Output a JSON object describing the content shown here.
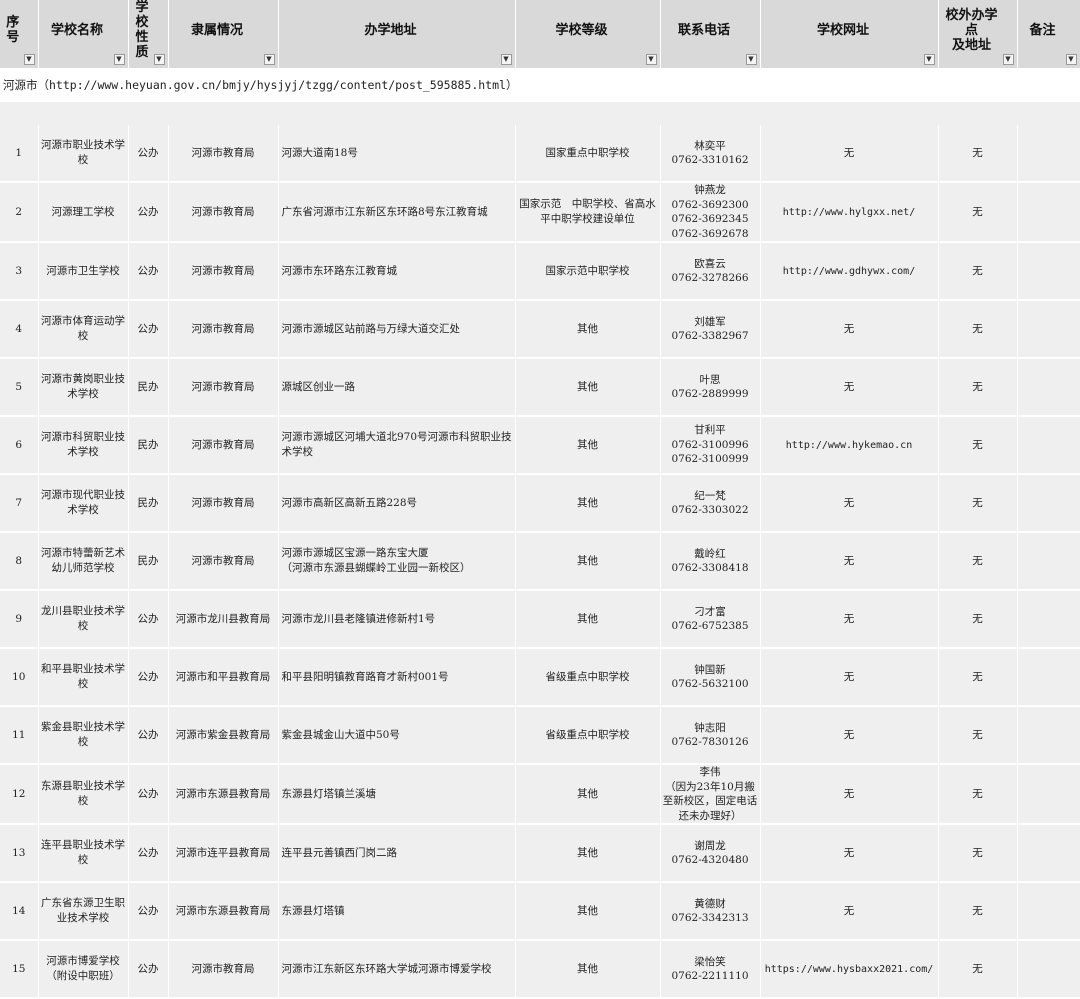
{
  "headers": [
    "序号",
    "学校名称",
    "学校\n性质",
    "隶属情况",
    "办学地址",
    "学校等级",
    "联系电话",
    "学校网址",
    "校外办学点\n及地址",
    "备注"
  ],
  "filter_icon": "dropdown-arrow",
  "city_row": "河源市（http://www.heyuan.gov.cn/bmjy/hysjyj/tzgg/content/post_595885.html）",
  "rows": [
    {
      "no": "1",
      "name": "河源市职业技术学校",
      "nature": "公办",
      "affiliation": "河源市教育局",
      "address": "河源大道南18号",
      "level": "国家重点中职学校",
      "phone": "林奕平\n0762-3310162",
      "website": "无",
      "offsite": "无",
      "remark": ""
    },
    {
      "no": "2",
      "name": "河源理工学校",
      "nature": "公办",
      "affiliation": "河源市教育局",
      "address": "广东省河源市江东新区东环路8号东江教育城",
      "level": "国家示范　中职学校、省高水平中职学校建设单位",
      "phone": "钟燕龙\n0762-3692300\n0762-3692345\n0762-3692678",
      "website": "http://www.hylgxx.net/",
      "offsite": "无",
      "remark": ""
    },
    {
      "no": "3",
      "name": "河源市卫生学校",
      "nature": "公办",
      "affiliation": "河源市教育局",
      "address": "河源市东环路东江教育城",
      "level": "国家示范中职学校",
      "phone": "欧喜云\n0762-3278266",
      "website": "http://www.gdhywx.com/",
      "offsite": "无",
      "remark": ""
    },
    {
      "no": "4",
      "name": "河源市体育运动学校",
      "nature": "公办",
      "affiliation": "河源市教育局",
      "address": "河源市源城区站前路与万绿大道交汇处",
      "level": "其他",
      "phone": "刘雄军\n0762-3382967",
      "website": "无",
      "offsite": "无",
      "remark": ""
    },
    {
      "no": "5",
      "name": "河源市黄岗职业技术学校",
      "nature": "民办",
      "affiliation": "河源市教育局",
      "address": "源城区创业一路",
      "level": "其他",
      "phone": "叶思\n0762-2889999",
      "website": "无",
      "offsite": "无",
      "remark": ""
    },
    {
      "no": "6",
      "name": "河源市科贸职业技术学校",
      "nature": "民办",
      "affiliation": "河源市教育局",
      "address": "河源市源城区河埔大道北970号河源市科贸职业技术学校",
      "level": "其他",
      "phone": "甘利平\n0762-3100996\n0762-3100999",
      "website": "http://www.hykemao.cn",
      "offsite": "无",
      "remark": ""
    },
    {
      "no": "7",
      "name": "河源市现代职业技术学校",
      "nature": "民办",
      "affiliation": "河源市教育局",
      "address": "河源市高新区高新五路228号",
      "level": "其他",
      "phone": "纪一梵\n0762-3303022",
      "website": "无",
      "offsite": "无",
      "remark": ""
    },
    {
      "no": "8",
      "name": "河源市特蕾新艺术幼儿师范学校",
      "nature": "民办",
      "affiliation": "河源市教育局",
      "address": "河源市源城区宝源一路东宝大厦\n（河源市东源县蝴蝶岭工业园一新校区）",
      "level": "其他",
      "phone": "戴岭红\n0762-3308418",
      "website": "无",
      "offsite": "无",
      "remark": ""
    },
    {
      "no": "9",
      "name": "龙川县职业技术学校",
      "nature": "公办",
      "affiliation": "河源市龙川县教育局",
      "address": "河源市龙川县老隆镇进修新村1号",
      "level": "其他",
      "phone": "刁才富\n0762-6752385",
      "website": "无",
      "offsite": "无",
      "remark": ""
    },
    {
      "no": "10",
      "name": "和平县职业技术学校",
      "nature": "公办",
      "affiliation": "河源市和平县教育局",
      "address": "和平县阳明镇教育路育才新村001号",
      "level": "省级重点中职学校",
      "phone": "钟国新\n0762-5632100",
      "website": "无",
      "offsite": "无",
      "remark": ""
    },
    {
      "no": "11",
      "name": "紫金县职业技术学校",
      "nature": "公办",
      "affiliation": "河源市紫金县教育局",
      "address": "紫金县城金山大道中50号",
      "level": "省级重点中职学校",
      "phone": "钟志阳\n0762-7830126",
      "website": "无",
      "offsite": "无",
      "remark": ""
    },
    {
      "no": "12",
      "name": "东源县职业技术学校",
      "nature": "公办",
      "affiliation": "河源市东源县教育局",
      "address": "东源县灯塔镇兰溪塘",
      "level": "其他",
      "phone": "李伟\n（因为23年10月搬至新校区，固定电话还未办理好）",
      "website": "无",
      "offsite": "无",
      "remark": ""
    },
    {
      "no": "13",
      "name": "连平县职业技术学校",
      "nature": "公办",
      "affiliation": "河源市连平县教育局",
      "address": "连平县元善镇西门岗二路",
      "level": "其他",
      "phone": "谢周龙\n0762-4320480",
      "website": "无",
      "offsite": "无",
      "remark": ""
    },
    {
      "no": "14",
      "name": "广东省东源卫生职业技术学校",
      "nature": "公办",
      "affiliation": "河源市东源县教育局",
      "address": "东源县灯塔镇",
      "level": "其他",
      "phone": "黄德财\n0762-3342313",
      "website": "无",
      "offsite": "无",
      "remark": ""
    },
    {
      "no": "15",
      "name": "河源市博爱学校（附设中职班）",
      "nature": "公办",
      "affiliation": "河源市教育局",
      "address": "河源市江东新区东环路大学城河源市博爱学校",
      "level": "其他",
      "phone": "梁怡笑\n0762-2211110",
      "website": "https://www.hysbaxx2021.com/",
      "offsite": "无",
      "remark": ""
    }
  ]
}
